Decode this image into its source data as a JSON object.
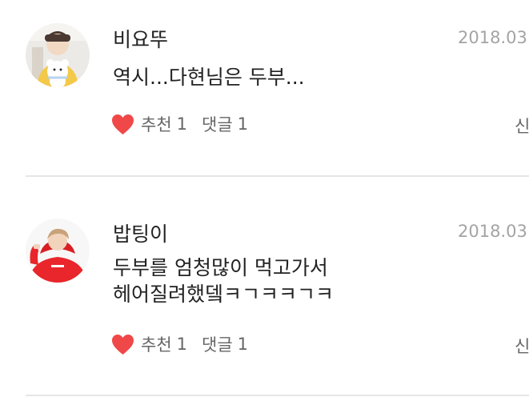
{
  "comments": [
    {
      "nickname": "비요뚜",
      "date": "2018.03.",
      "text_lines": [
        "역시...다현님은 두부..."
      ],
      "like_label": "추천",
      "like_count": "1",
      "reply_label": "댓글",
      "reply_count": "1",
      "report_label": "신",
      "avatar_icon": "profile-photo-holding-plush-bear",
      "heart_color": "#f04848"
    },
    {
      "nickname": "밥팅이",
      "date": "2018.03.",
      "text_lines": [
        "두부를 엄청많이 먹고가서",
        "헤어질려했뎈ㅋㄱㅋㅋㄱㅋ"
      ],
      "like_label": "추천",
      "like_count": "1",
      "reply_label": "댓글",
      "reply_count": "1",
      "report_label": "신",
      "avatar_icon": "profile-photo-red-hoodie",
      "heart_color": "#f04848"
    }
  ]
}
